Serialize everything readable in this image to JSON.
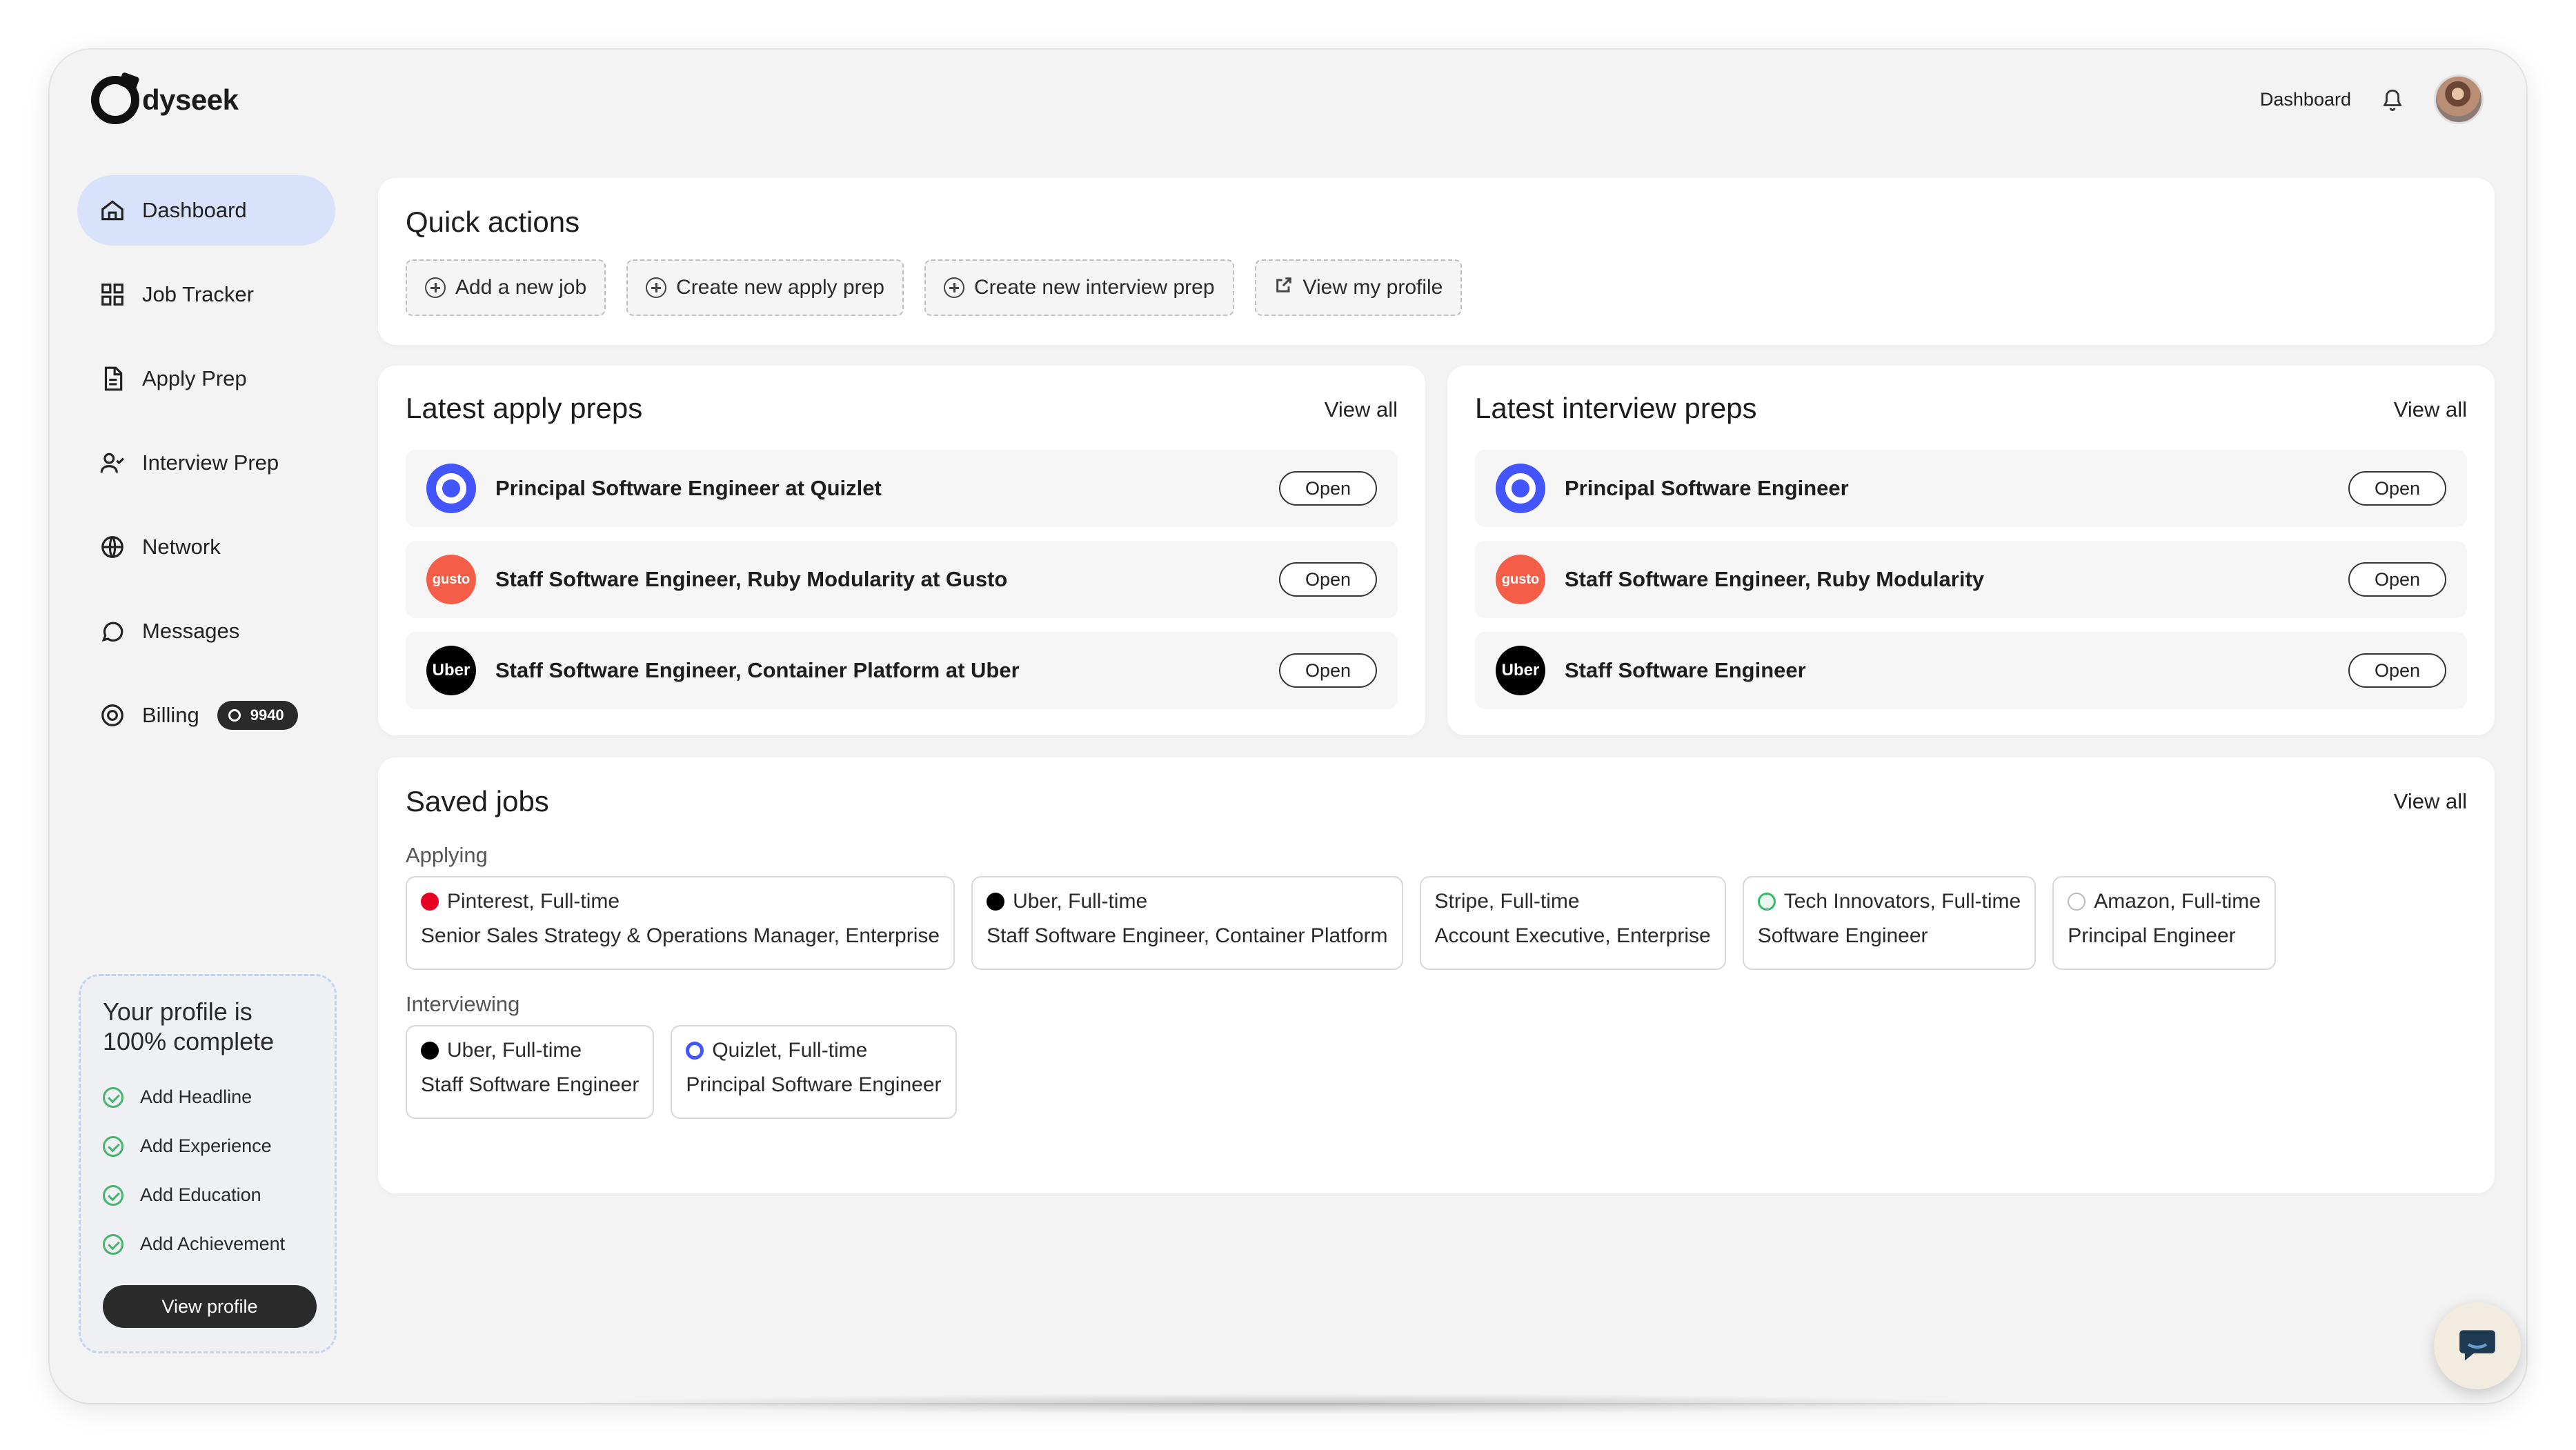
{
  "brand": {
    "logo_text": "dyseek"
  },
  "header": {
    "dashboard_link": "Dashboard"
  },
  "sidebar": {
    "items": [
      {
        "label": "Dashboard",
        "icon": "home-icon",
        "active": true
      },
      {
        "label": "Job Tracker",
        "icon": "grid-icon"
      },
      {
        "label": "Apply Prep",
        "icon": "document-icon"
      },
      {
        "label": "Interview Prep",
        "icon": "user-check-icon"
      },
      {
        "label": "Network",
        "icon": "globe-icon"
      },
      {
        "label": "Messages",
        "icon": "chat-icon"
      },
      {
        "label": "Billing",
        "icon": "coin-icon",
        "badge": "9940"
      }
    ]
  },
  "profile_card": {
    "title": "Your profile is 100% complete",
    "items": [
      "Add Headline",
      "Add Experience",
      "Add Education",
      "Add Achievement"
    ],
    "button": "View profile"
  },
  "quick_actions": {
    "title": "Quick actions",
    "buttons": [
      "Add a new job",
      "Create new apply prep",
      "Create new interview prep",
      "View my profile"
    ]
  },
  "latest_apply_preps": {
    "title": "Latest apply preps",
    "view_all": "View all",
    "items": [
      {
        "title": "Principal Software Engineer at Quizlet",
        "company": "Quizlet",
        "action": "Open"
      },
      {
        "title": "Staff Software Engineer, Ruby Modularity at Gusto",
        "company": "gusto",
        "action": "Open"
      },
      {
        "title": "Staff Software Engineer, Container Platform at Uber",
        "company": "Uber",
        "action": "Open"
      }
    ]
  },
  "latest_interview_preps": {
    "title": "Latest interview preps",
    "view_all": "View all",
    "items": [
      {
        "title": "Principal Software Engineer",
        "company": "Quizlet",
        "action": "Open"
      },
      {
        "title": "Staff Software Engineer, Ruby Modularity",
        "company": "gusto",
        "action": "Open"
      },
      {
        "title": "Staff Software Engineer",
        "company": "Uber",
        "action": "Open"
      }
    ]
  },
  "saved_jobs": {
    "title": "Saved jobs",
    "view_all": "View all",
    "applying_label": "Applying",
    "interviewing_label": "Interviewing",
    "applying": [
      {
        "company": "Pinterest, Full-time",
        "title": "Senior Sales Strategy & Operations Manager, Enterprise"
      },
      {
        "company": "Uber, Full-time",
        "title": "Staff Software Engineer, Container Platform"
      },
      {
        "company": "Stripe, Full-time",
        "title": "Account Executive, Enterprise"
      },
      {
        "company": "Tech Innovators, Full-time",
        "title": "Software Engineer"
      },
      {
        "company": "Amazon, Full-time",
        "title": "Principal Engineer"
      }
    ],
    "interviewing": [
      {
        "company": "Uber, Full-time",
        "title": "Staff Software Engineer"
      },
      {
        "company": "Quizlet, Full-time",
        "title": "Principal Software Engineer"
      }
    ]
  },
  "colors": {
    "accent": "#d9e2fb",
    "quizlet": "#4255ff",
    "gusto": "#f45d48",
    "success": "#47b36e"
  }
}
